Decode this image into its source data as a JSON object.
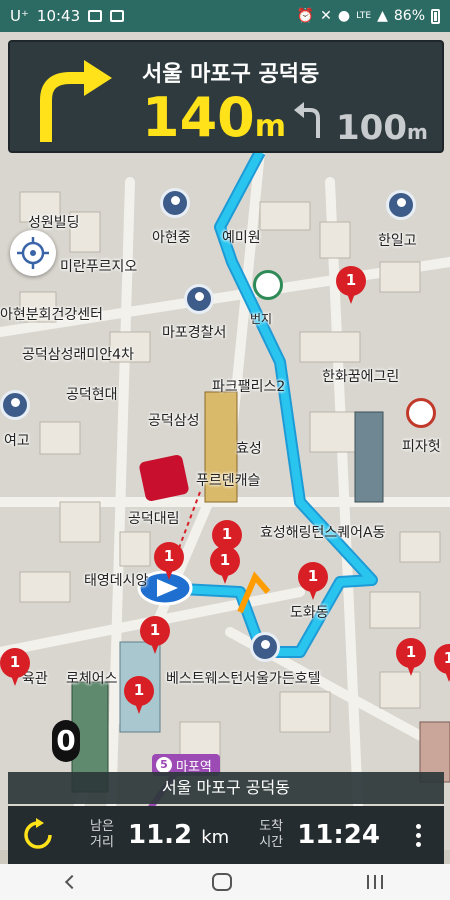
{
  "status": {
    "carrier": "U⁺",
    "time": "10:43",
    "network": "LTE",
    "battery": "86%"
  },
  "guidance": {
    "address": "서울 마포구 공덕동",
    "distance_value": "140",
    "distance_unit": "m",
    "next_distance_value": "100",
    "next_distance_unit": "m",
    "turn_icon": "turn-right-arrow",
    "next_turn_icon": "turn-left-arrow"
  },
  "map": {
    "labels": [
      "성원빌딩",
      "아현중",
      "예미원",
      "한일고",
      "미란푸르지오",
      "아현분회건강센터",
      "마포경찰서",
      "공덕삼성래미안4차",
      "공덕현대",
      "파크팰리스2",
      "한화꿈에그린",
      "여고",
      "공덕삼성",
      "효성",
      "피자헛",
      "푸르덴캐슬",
      "공덕대림",
      "효성해링턴스퀘어A동",
      "태영데시앙",
      "도화동",
      "육관",
      "로체어스",
      "베스트웨스턴서울가든호텔",
      "번지"
    ],
    "pins": [
      "1",
      "1",
      "1",
      "1",
      "1",
      "1",
      "1",
      "1",
      "1",
      "1"
    ],
    "station_line": "5",
    "station_name": "마포역",
    "speed_digit": "0"
  },
  "bottom": {
    "current_address": "서울 마포구 공덕동",
    "remaining_label_1": "남은",
    "remaining_label_2": "거리",
    "remaining_value": "11.2",
    "remaining_unit": "km",
    "arrival_label_1": "도착",
    "arrival_label_2": "시간",
    "arrival_value": "11:24"
  },
  "colors": {
    "route": "#29c5ef",
    "pin": "#d81f26",
    "panel": "#2f3a3e",
    "highlight": "#ffe21a",
    "station": "#9d4bb4"
  }
}
